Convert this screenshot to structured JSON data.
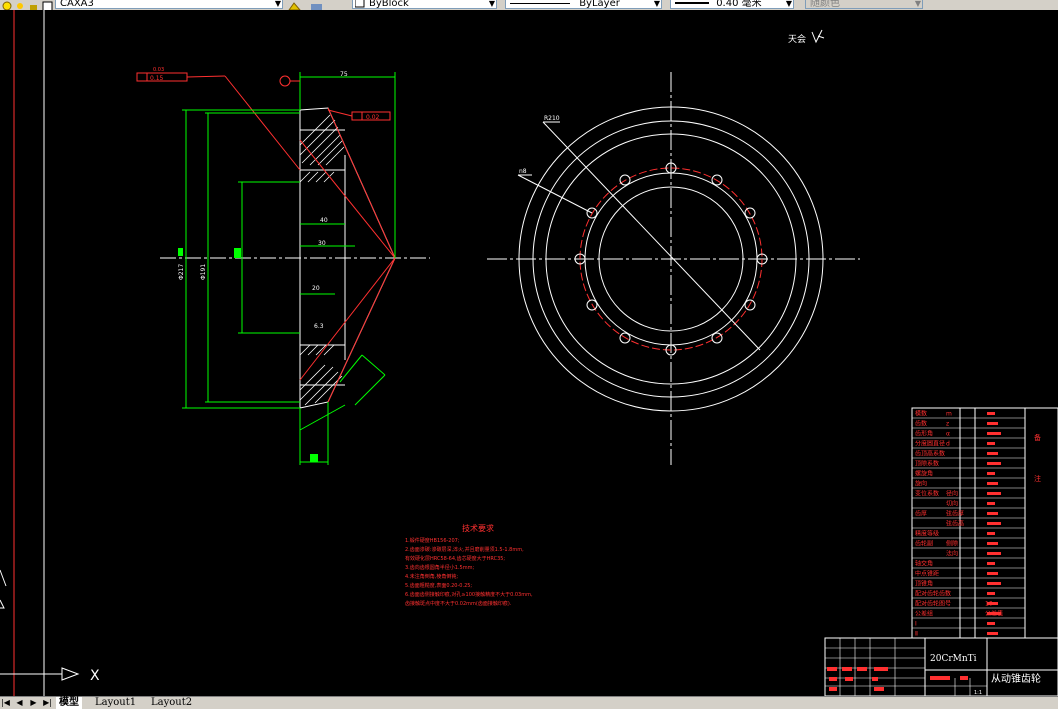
{
  "toolbar": {
    "layer_name": "CAXA3",
    "linetype_label": "ByBlock",
    "layer_label": "ByLayer",
    "lineweight_label": "0.40 毫米",
    "color_label": "随颜色"
  },
  "drawing": {
    "title_small": "天会",
    "dim_top_width": "75",
    "dim_d1": "Φ217",
    "dim_d2": "Φ191",
    "dim_40": "40",
    "dim_30": "30",
    "dim_20": "20",
    "dim_r": "R210",
    "dim_n": "n8",
    "tol_box1": "0.03",
    "tol_box2": "0.15",
    "tol_box3": "0.02",
    "roughness": "6.3"
  },
  "tech_req": {
    "title": "技术要求",
    "lines": [
      "1.锻件硬度HB156-207;",
      "2.齿面渗碳:渗碳层深,淬火,并且磨削量须1.5-1.8mm,",
      "   有效硬化层HRC58-64,齿芯硬度大于HRC35;",
      "3.齿向齿根圆角半径小1.5mm;",
      "4.未注角倒角,棱角倒钝;",
      "5.齿面粗糙度,表面0.20-0.25;",
      "6.齿面齿侧接触印痕,对孔≥100接触精度不大于0.03mm,",
      "   齿接触斑点中度不大于0.02mm(齿面接触印痕)."
    ]
  },
  "param_table": {
    "rows": [
      {
        "label": "模数",
        "v1": "m",
        "v2": ""
      },
      {
        "label": "齿数",
        "v1": "z",
        "v2": ""
      },
      {
        "label": "齿形角",
        "v1": "α",
        "v2": ""
      },
      {
        "label": "分度圆直径",
        "v1": "d",
        "v2": ""
      },
      {
        "label": "齿顶高系数",
        "v1": "",
        "v2": ""
      },
      {
        "label": "顶隙系数",
        "v1": "",
        "v2": ""
      },
      {
        "label": "螺旋角",
        "v1": "",
        "v2": ""
      },
      {
        "label": "旋向",
        "v1": "",
        "v2": ""
      },
      {
        "label": "变位系数",
        "v1": "径向",
        "v2": ""
      },
      {
        "label": "",
        "v1": "切向",
        "v2": ""
      },
      {
        "label": "齿厚",
        "v1": "弦齿厚",
        "v2": ""
      },
      {
        "label": "",
        "v1": "弦齿高",
        "v2": ""
      },
      {
        "label": "精度等级",
        "v1": "",
        "v2": ""
      },
      {
        "label": "齿轮副",
        "v1": "侧隙",
        "v2": ""
      },
      {
        "label": "",
        "v1": "法向",
        "v2": ""
      },
      {
        "label": "轴交角",
        "v1": "",
        "v2": ""
      },
      {
        "label": "中点锥距",
        "v1": "",
        "v2": ""
      },
      {
        "label": "顶锥角",
        "v1": "",
        "v2": ""
      },
      {
        "label": "配对齿轮齿数",
        "v1": "",
        "v2": ""
      },
      {
        "label": "配对齿轮图号",
        "v1": "",
        "v2": "10"
      },
      {
        "label": "公差组",
        "v1": "",
        "v2": "公差值"
      },
      {
        "label": "Ⅰ",
        "v1": "",
        "v2": ""
      },
      {
        "label": "Ⅱ",
        "v1": "",
        "v2": ""
      }
    ],
    "side_labels": [
      "备",
      "注"
    ]
  },
  "title_block": {
    "material": "20CrMnTi",
    "part_name": "从动锥齿轮",
    "scale": "1:1"
  },
  "ucs": {
    "x_label": "X"
  },
  "tabs": [
    "模型",
    "Layout1",
    "Layout2"
  ]
}
